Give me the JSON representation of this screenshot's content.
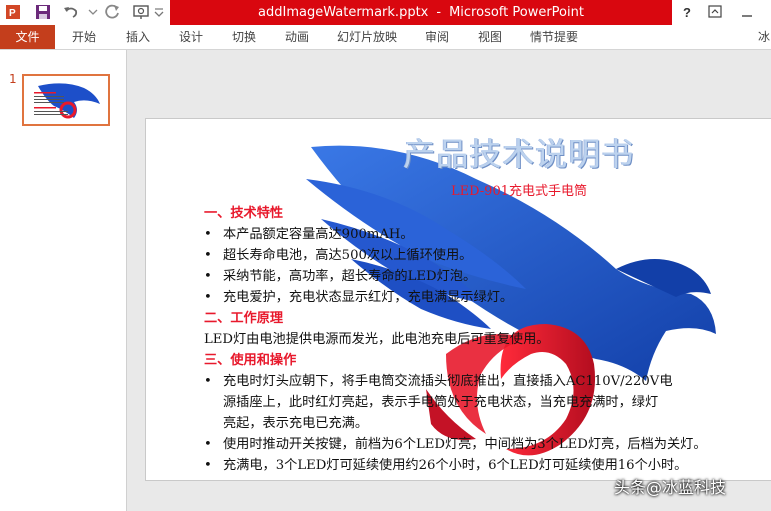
{
  "window": {
    "title_file": "addImageWatermark.pptx",
    "title_sep": "-",
    "title_app": "Microsoft PowerPoint"
  },
  "ribbon": {
    "tabs": [
      "文件",
      "开始",
      "插入",
      "设计",
      "切换",
      "动画",
      "幻灯片放映",
      "审阅",
      "视图",
      "情节提要"
    ],
    "user": "冰"
  },
  "thumbnails": {
    "slide_number": "1"
  },
  "slide": {
    "title": "产品技术说明书",
    "subtitle": "LED-901充电式手电筒",
    "sections": [
      {
        "type": "heading",
        "text": "一、技术特性"
      },
      {
        "type": "bullet",
        "text": "本产品额定容量高达900mAH。"
      },
      {
        "type": "bullet",
        "text": "超长寿命电池，高达500次以上循环使用。"
      },
      {
        "type": "bullet",
        "text": "采纳节能，高功率，超长寿命的LED灯泡。"
      },
      {
        "type": "bullet",
        "text": "充电爱护，充电状态显示红灯，充电满显示绿灯。"
      },
      {
        "type": "heading",
        "text": "二、工作原理"
      },
      {
        "type": "plain",
        "text": "LED灯由电池提供电源而发光，此电池充电后可重复使用。"
      },
      {
        "type": "heading",
        "text": "三、使用和操作"
      },
      {
        "type": "bullet3",
        "lines": [
          "充电时灯头应朝下，将手电筒交流插头彻底推出，直接插入AC110V/220V电",
          "源插座上，此时红灯亮起，表示手电筒处于充电状态，当充电充满时，绿灯",
          "亮起，表示充电已充满。"
        ]
      },
      {
        "type": "bullet",
        "text": "使用时推动开关按键，前档为6个LED灯亮，中间档为3个LED灯亮，后档为关灯。"
      },
      {
        "type": "bullet",
        "text": "充满电，3个LED灯可延续使用约26个小时，6个LED灯可延续使用16个小时。"
      }
    ]
  },
  "overlay_watermark": "头条@冰蓝科技",
  "colors": {
    "titlebar_red": "#d9070f",
    "file_tab": "#c43e1c",
    "heading_red": "#e8192c",
    "eagle_blue": "#1d4fc9",
    "swirl_red": "#e8192c"
  },
  "icons": [
    "powerpoint-logo-icon",
    "save-icon",
    "undo-icon",
    "redo-icon",
    "slideshow-icon",
    "help-icon",
    "ribbon-display-icon",
    "minimize-icon"
  ]
}
